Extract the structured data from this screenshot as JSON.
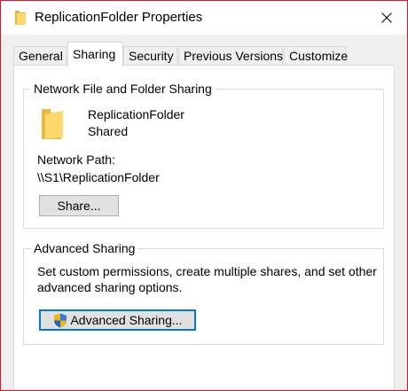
{
  "window": {
    "title": "ReplicationFolder Properties",
    "border_color": "#e81123"
  },
  "title_icons": {
    "folder": "folder-icon",
    "close": "close-icon"
  },
  "tabs": [
    {
      "label": "General",
      "active": false
    },
    {
      "label": "Sharing",
      "active": true
    },
    {
      "label": "Security",
      "active": false
    },
    {
      "label": "Previous Versions",
      "active": false
    },
    {
      "label": "Customize",
      "active": false
    }
  ],
  "network_sharing": {
    "group_title": "Network File and Folder Sharing",
    "folder_name": "ReplicationFolder",
    "status": "Shared",
    "path_label": "Network Path:",
    "path_value": "\\\\S1\\ReplicationFolder",
    "share_button": "Share..."
  },
  "advanced_sharing": {
    "group_title": "Advanced Sharing",
    "description_line1": "Set custom permissions, create multiple shares, and set other",
    "description_line2": "advanced sharing options.",
    "button_label": "Advanced Sharing...",
    "button_icon": "uac-shield-icon"
  },
  "colors": {
    "folder_yellow": "#ffd86b",
    "accent_blue": "#0078d7"
  }
}
